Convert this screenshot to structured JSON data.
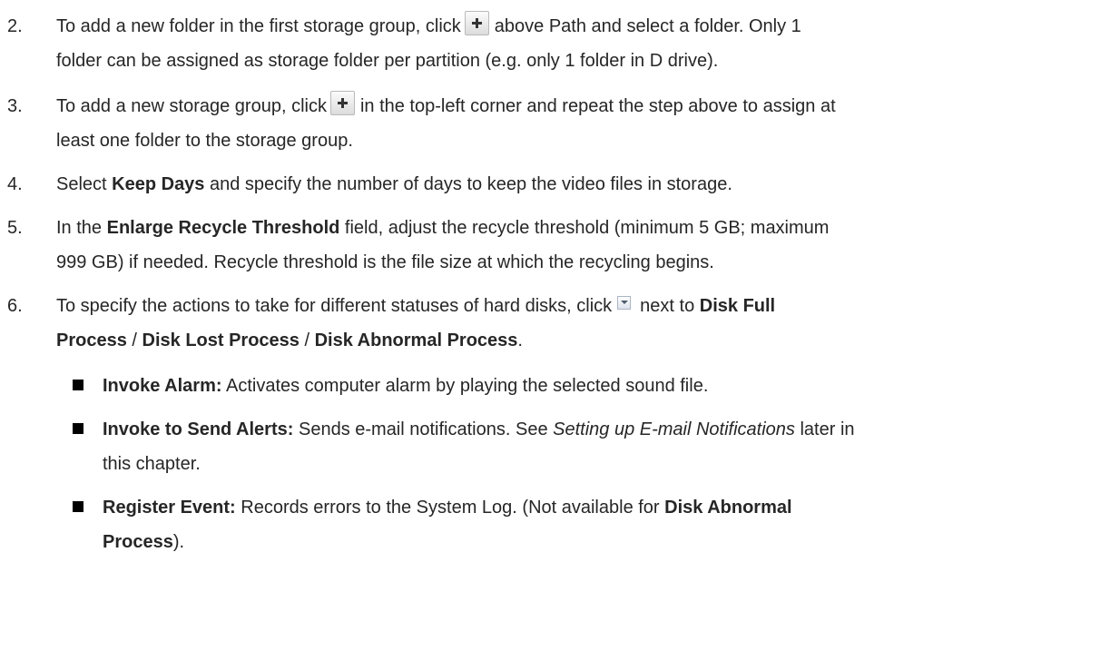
{
  "steps": [
    {
      "num": "2.",
      "line1_a": "To add a new folder in the first storage group, click",
      "line1_b": "above Path and select a folder. Only 1",
      "line2": "folder can be assigned as storage folder per partition (e.g. only 1 folder in D drive)."
    },
    {
      "num": "3.",
      "line1_a": "To add a new storage group, click",
      "line1_b": "in the top-left corner and repeat the step above to assign at",
      "line2": "least one folder to the storage group."
    },
    {
      "num": "4.",
      "a": "Select ",
      "b": "Keep Days",
      "c": " and specify the number of days to keep the video files in storage."
    },
    {
      "num": "5.",
      "a": "In the ",
      "b": "Enlarge Recycle Threshold",
      "c": " field, adjust the recycle threshold (minimum 5 GB; maximum",
      "line2": "999 GB) if needed. Recycle threshold is the file size at which the recycling begins."
    },
    {
      "num": "6.",
      "a": "To specify the actions to take for different statuses of hard disks, click",
      "b": "next to ",
      "c": "Disk Full",
      "d": "Process",
      "e": " / ",
      "f": "Disk Lost Process",
      "g": " / ",
      "h": "Disk Abnormal Process",
      "i": "."
    }
  ],
  "bullets": [
    {
      "label": "Invoke Alarm:",
      "text": " Activates computer alarm by playing the selected sound file."
    },
    {
      "label": "Invoke to Send Alerts:",
      "text": " Sends e-mail notifications. See ",
      "italic": "Setting up E-mail Notifications",
      "text2": " later in",
      "line2": "this chapter."
    },
    {
      "label": "Register Event:",
      "text": " Records errors to the System Log. (Not available for ",
      "bold2": "Disk Abnormal",
      "line2_bold": "Process",
      "line2_rest": ")."
    }
  ],
  "icons": {
    "add": "plus-icon",
    "dropdown": "dropdown-arrow-icon"
  }
}
